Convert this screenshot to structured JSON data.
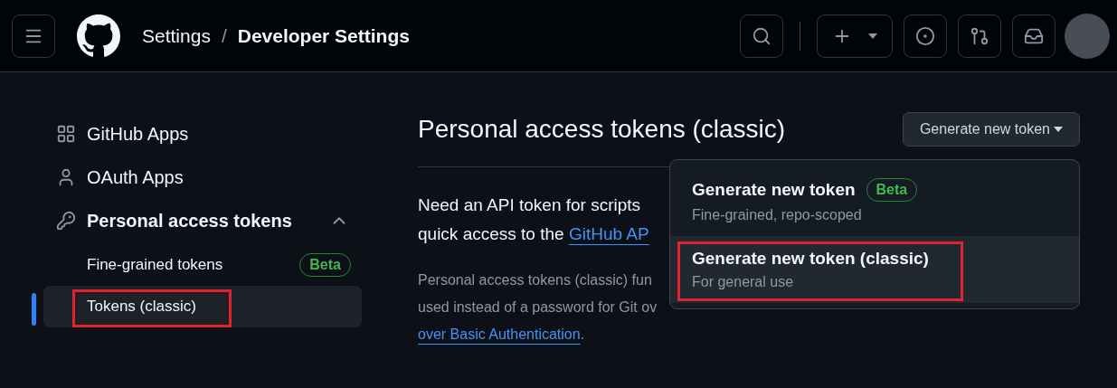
{
  "header": {
    "breadcrumbs": [
      {
        "label": "Settings",
        "current": false
      },
      {
        "label": "Developer Settings",
        "current": true
      }
    ],
    "separator": "/"
  },
  "sidebar": {
    "items": [
      {
        "kind": "apps",
        "label": "GitHub Apps"
      },
      {
        "kind": "person",
        "label": "OAuth Apps"
      },
      {
        "kind": "key",
        "label": "Personal access tokens",
        "expanded": true,
        "children": [
          {
            "label": "Fine-grained tokens",
            "badge": "Beta",
            "selected": false,
            "highlighted": false
          },
          {
            "label": "Tokens (classic)",
            "selected": true,
            "highlighted": true
          }
        ]
      }
    ]
  },
  "main": {
    "title": "Personal access tokens (classic)",
    "generate_button": "Generate new token",
    "intro": [
      {
        "text": "Need an API token for scripts"
      },
      {
        "text": "quick access to the ",
        "link": "GitHub AP"
      }
    ],
    "description": [
      {
        "text": "Personal access tokens (classic) fun"
      },
      {
        "text": "used instead of a password for Git ov"
      },
      {
        "link": "over Basic Authentication",
        "after": "."
      }
    ]
  },
  "menu": {
    "items": [
      {
        "title": "Generate new token",
        "badge": "Beta",
        "subtitle": "Fine-grained, repo-scoped",
        "hovered": false,
        "highlighted": false
      },
      {
        "title": "Generate new token (classic)",
        "subtitle": "For general use",
        "hovered": true,
        "highlighted": true
      }
    ]
  }
}
